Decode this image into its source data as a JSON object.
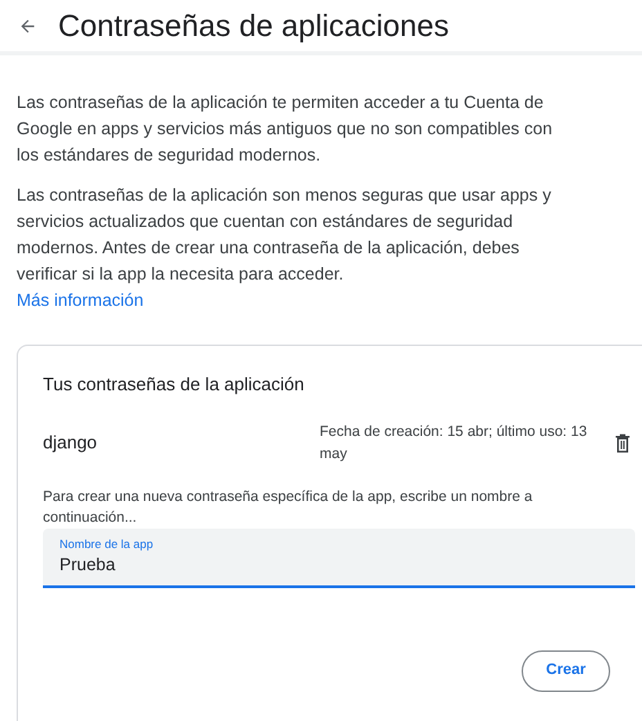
{
  "header": {
    "title": "Contraseñas de aplicaciones"
  },
  "intro": {
    "paragraphs": [
      "Las contraseñas de la aplicación te permiten acceder a tu Cuenta de Google en apps y servicios más antiguos que no son compatibles con los estándares de seguridad modernos.",
      "Las contraseñas de la aplicación son menos seguras que usar apps y servicios actualizados que cuentan con estándares de seguridad modernos. Antes de crear una contraseña de la aplicación, debes verificar si la app la necesita para acceder."
    ],
    "link": "Más información"
  },
  "card": {
    "title": "Tus contraseñas de la aplicación",
    "passwords": [
      {
        "name": "django",
        "details": "Fecha de creación: 15 abr; último uso: 13 may"
      }
    ],
    "instructions": "Para crear una nueva contraseña específica de la app, escribe un nombre a continuación...",
    "field": {
      "label": "Nombre de la app",
      "value": "Prueba"
    },
    "button": "Crear"
  }
}
